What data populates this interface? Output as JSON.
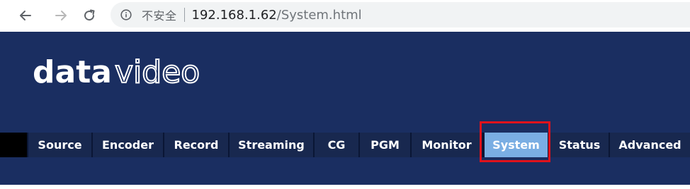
{
  "browser": {
    "security_label": "不安全",
    "url_host": "192.168.1.62",
    "url_path": "/System.html",
    "icons": {
      "back": "back-arrow-icon",
      "forward": "forward-arrow-icon",
      "reload": "reload-icon",
      "info": "info-icon"
    }
  },
  "page": {
    "logo": {
      "text_bold": "data",
      "text_outline": "video"
    },
    "menu": [
      {
        "label": "Source"
      },
      {
        "label": "Encoder"
      },
      {
        "label": "Record"
      },
      {
        "label": "Streaming"
      },
      {
        "label": "CG"
      },
      {
        "label": "PGM"
      },
      {
        "label": "Monitor"
      },
      {
        "label": "System",
        "active": true
      },
      {
        "label": "Status"
      },
      {
        "label": "Advanced"
      }
    ],
    "colors": {
      "background": "#1a2e61",
      "menu_item": "#18284f",
      "menu_active": "#7aaee3",
      "highlight": "#e0121b"
    }
  }
}
